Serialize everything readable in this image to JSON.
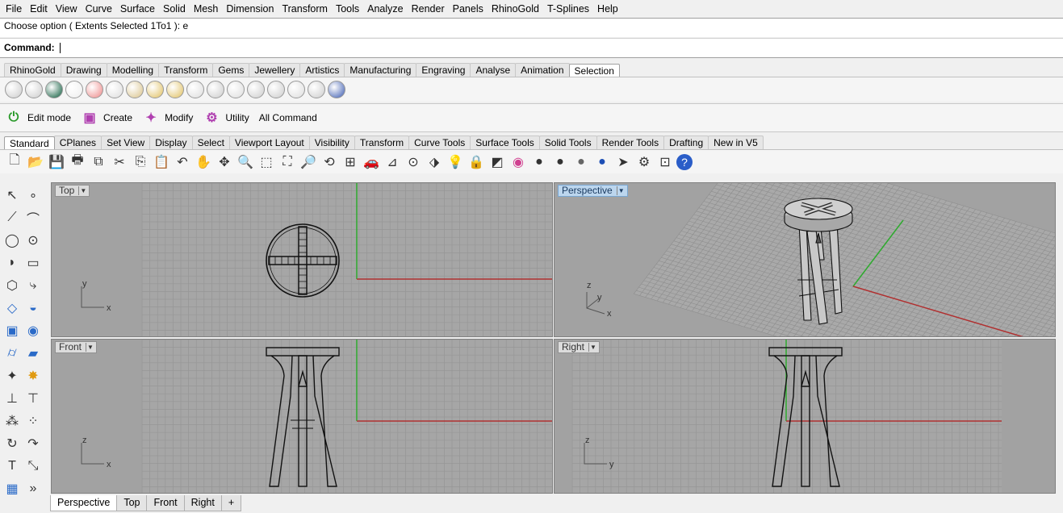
{
  "menu": [
    "File",
    "Edit",
    "View",
    "Curve",
    "Surface",
    "Solid",
    "Mesh",
    "Dimension",
    "Transform",
    "Tools",
    "Analyze",
    "Render",
    "Panels",
    "RhinoGold",
    "T-Splines",
    "Help"
  ],
  "history_line": "Choose option ( Extents  Selected  1To1 ): e",
  "command_label": "Command:",
  "command_value": "",
  "gold_tabs": [
    "RhinoGold",
    "Drawing",
    "Modelling",
    "Transform",
    "Gems",
    "Jewellery",
    "Artistics",
    "Manufacturing",
    "Engraving",
    "Analyse",
    "Animation",
    "Selection"
  ],
  "gold_active_tab": "Selection",
  "tsplines_bar": {
    "edit_mode": "Edit mode",
    "create": "Create",
    "modify": "Modify",
    "utility": "Utility",
    "all_command": "All Command"
  },
  "std_tabs": [
    "Standard",
    "CPlanes",
    "Set View",
    "Display",
    "Select",
    "Viewport Layout",
    "Visibility",
    "Transform",
    "Curve Tools",
    "Surface Tools",
    "Solid Tools",
    "Render Tools",
    "Drafting",
    "New in V5"
  ],
  "std_active_tab": "Standard",
  "viewports": {
    "top": {
      "label": "Top",
      "axis1": "x",
      "axis2": "y"
    },
    "perspective": {
      "label": "Perspective",
      "axis1": "x",
      "axis2": "y",
      "axis3": "z"
    },
    "front": {
      "label": "Front",
      "axis1": "x",
      "axis2": "z"
    },
    "right": {
      "label": "Right",
      "axis1": "y",
      "axis2": "z"
    }
  },
  "active_viewport": "Perspective",
  "bottom_tabs": [
    "Perspective",
    "Top",
    "Front",
    "Right"
  ],
  "bottom_add": "+",
  "sidebar_more": "»",
  "colors": {
    "viewport_bg": "#a2a2a2",
    "grid_minor": "#969696",
    "grid_major": "#8a8a8a",
    "x_axis": "#b03030",
    "y_axis": "#2faa2f",
    "active_label": "#bcd6ee"
  }
}
